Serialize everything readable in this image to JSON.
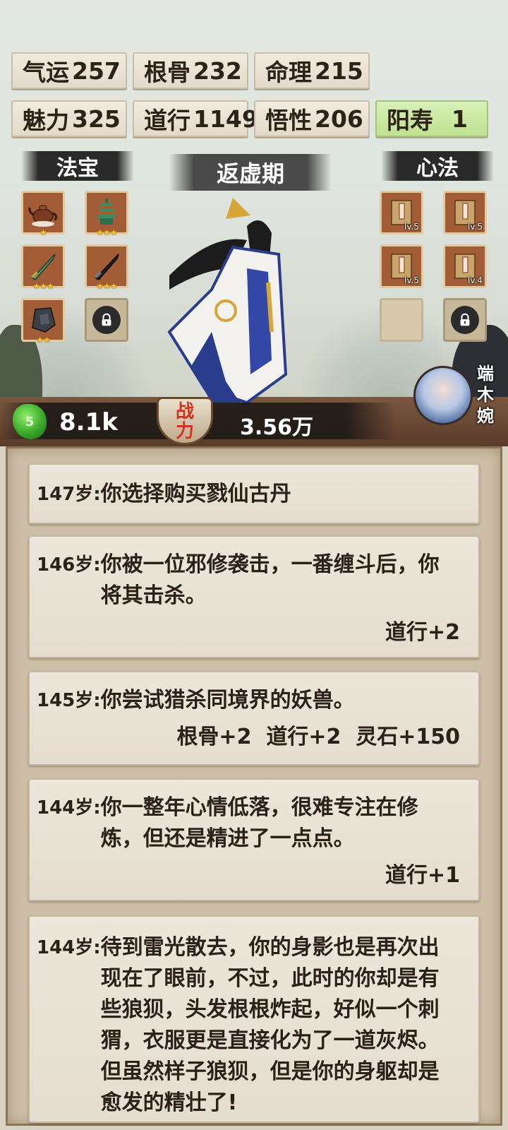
{
  "stats": [
    {
      "label": "气运",
      "value": "257"
    },
    {
      "label": "根骨",
      "value": "232"
    },
    {
      "label": "命理",
      "value": "215"
    },
    {
      "label": "魅力",
      "value": "325"
    },
    {
      "label": "道行",
      "value": "1149"
    },
    {
      "label": "悟性",
      "value": "206"
    },
    {
      "label": "阳寿",
      "value": "1"
    }
  ],
  "treasure": {
    "title": "法宝",
    "slots": [
      {
        "icon": "teapot-icon",
        "stars": "★"
      },
      {
        "icon": "pagoda-icon",
        "stars": "★★★"
      },
      {
        "icon": "jade-sword-icon",
        "stars": "★★★"
      },
      {
        "icon": "dark-sword-icon",
        "stars": "★★★"
      },
      {
        "icon": "seal-stone-icon",
        "stars": "★★"
      },
      {
        "icon": "lock-icon",
        "stars": ""
      }
    ]
  },
  "realm": "返虚期",
  "technique": {
    "title": "心法",
    "slots": [
      {
        "icon": "scripture-book-icon",
        "level": "lv.5"
      },
      {
        "icon": "scripture-book-icon",
        "level": "lv.5"
      },
      {
        "icon": "scripture-book-icon",
        "level": "lv.5"
      },
      {
        "icon": "scripture-book-icon",
        "level": "lv.4"
      },
      {
        "icon": "empty-slot",
        "level": ""
      },
      {
        "icon": "lock-icon",
        "level": ""
      }
    ]
  },
  "spirit_stone": {
    "icon_text": "5",
    "value": "8.1k"
  },
  "combat_power": {
    "label_top": "战",
    "label_bottom": "力",
    "value": "3.56万"
  },
  "companion": {
    "name": "端木婉"
  },
  "logs": [
    {
      "age": "147岁:",
      "text": "你选择购买戮仙古丹",
      "reward": ""
    },
    {
      "age": "146岁:",
      "text": "你被一位邪修袭击，一番缠斗后，你将其击杀。",
      "reward": "道行+2"
    },
    {
      "age": "145岁:",
      "text": "你尝试猎杀同境界的妖兽。",
      "reward": "根骨+2  道行+2  灵石+150"
    },
    {
      "age": "144岁:",
      "text": "你一整年心情低落，很难专注在修炼，但还是精进了一点点。",
      "reward": "道行+1"
    },
    {
      "age": "144岁:",
      "text": "待到雷光散去，你的身影也是再次出现在了眼前，不过，此时的你却是有些狼狈，头发根根炸起，好似一个刺猬，衣服更是直接化为了一道灰烬。但虽然样子狼狈，但是你的身躯却是愈发的精壮了!",
      "reward": ""
    }
  ],
  "colors": {
    "accent_green": "#bfe291",
    "power_red": "#d5311f",
    "panel_bg": "#cdbfa7"
  }
}
